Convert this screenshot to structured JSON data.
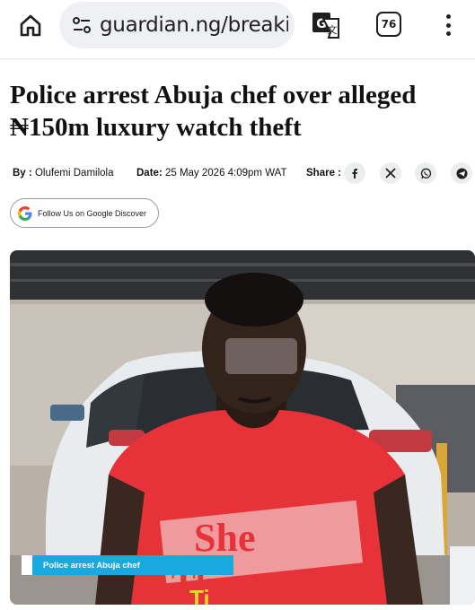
{
  "browser": {
    "url": "guardian.ng/breaking",
    "tab_count": "76"
  },
  "article": {
    "headline": "Police arrest Abuja chef over alleged ₦150m luxury watch theft",
    "by_label": "By :",
    "author": "Olufemi Damilola",
    "date_label": "Date:",
    "date": "25 May 2026 4:09pm WAT",
    "share_label": "Share :",
    "share_icons": [
      "facebook-icon",
      "x-icon",
      "whatsapp-icon",
      "telegram-icon"
    ],
    "discover_label": "Follow Us on Google Discover",
    "image_caption": "Police arrest Abuja chef"
  },
  "photo_shirt_text": [
    "She",
    "Ther",
    "Ti"
  ],
  "colors": {
    "caption_bar": "#1aa8e0",
    "shirt": "#e8323a"
  }
}
